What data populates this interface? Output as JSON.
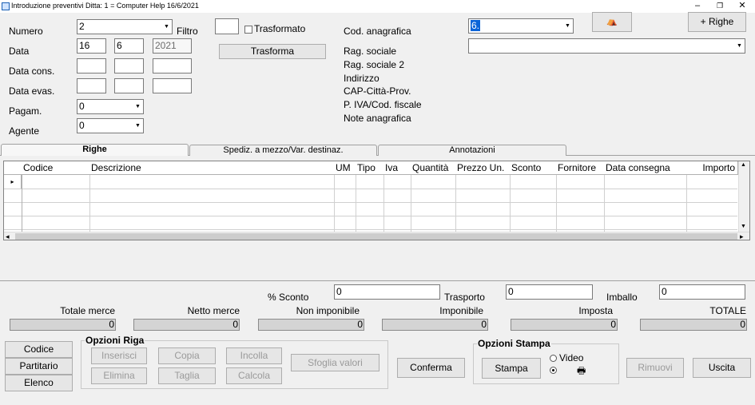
{
  "window": {
    "title": "Introduzione preventivi  Ditta: 1 = Computer Help  16/6/2021",
    "minimize": "–",
    "restore": "❐",
    "close": "✕"
  },
  "form": {
    "numero_label": "Numero",
    "numero_value": "2",
    "filtro_label": "Filtro",
    "data_label": "Data",
    "data_day": "16",
    "data_month": "6",
    "data_year": "2021",
    "data_cons_label": "Data cons.",
    "data_evas_label": "Data evas.",
    "pagam_label": "Pagam.",
    "pagam_value": "0",
    "agente_label": "Agente",
    "agente_value": "0",
    "trasformato_label": "Trasformato",
    "trasforma_label": "Trasforma",
    "cod_anagrafica_label": "Cod. anagrafica",
    "cod_anagrafica_value": "6.",
    "binocular_glyph": "⛺",
    "righe_button": "+ Righe",
    "rag_sociale_label": "Rag. sociale",
    "rag_sociale2_label": "Rag. sociale 2",
    "indirizzo_label": "Indirizzo",
    "cap_label": "CAP-Città-Prov.",
    "piva_label": "P. IVA/Cod. fiscale",
    "note_label": "Note anagrafica"
  },
  "tabs": [
    {
      "label": "Righe"
    },
    {
      "label": "Spediz. a mezzo/Var. destinaz."
    },
    {
      "label": "Annotazioni"
    }
  ],
  "grid": {
    "columns": [
      "Codice",
      "Descrizione",
      "UM",
      "Tipo",
      "Iva",
      "Quantità",
      "Prezzo Un.",
      "Sconto",
      "Fornitore",
      "Data consegna",
      "Importo"
    ],
    "current_row_marker": "▸",
    "scroll_up": "▲",
    "scroll_down": "▼",
    "scroll_left": "◂",
    "scroll_right": "▸"
  },
  "discounts": {
    "sconto_label": "% Sconto",
    "sconto_value": "0",
    "trasporto_label": "Trasporto",
    "trasporto_value": "0",
    "imballo_label": "Imballo",
    "imballo_value": "0"
  },
  "totals": [
    {
      "label": "Totale merce",
      "value": "0"
    },
    {
      "label": "Netto merce",
      "value": "0"
    },
    {
      "label": "Non imponibile",
      "value": "0"
    },
    {
      "label": "Imponibile",
      "value": "0"
    },
    {
      "label": "Imposta",
      "value": "0"
    },
    {
      "label": "TOTALE",
      "value": "0"
    }
  ],
  "left_buttons": {
    "codice": "Codice",
    "partitario": "Partitario",
    "elenco": "Elenco"
  },
  "opzioni_riga": {
    "title": "Opzioni Riga",
    "inserisci": "Inserisci",
    "copia": "Copia",
    "incolla": "Incolla",
    "elimina": "Elimina",
    "taglia": "Taglia",
    "calcola": "Calcola",
    "sfoglia": "Sfoglia valori"
  },
  "conferma": "Conferma",
  "opzioni_stampa": {
    "title": "Opzioni Stampa",
    "stampa": "Stampa",
    "video": "Video",
    "printer_glyph": "🖶"
  },
  "rimuovi": "Rimuovi",
  "uscita": "Uscita"
}
